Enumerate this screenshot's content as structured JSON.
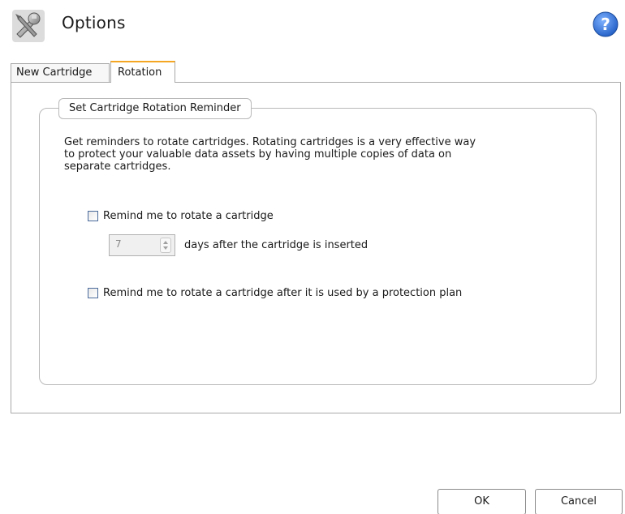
{
  "header": {
    "title": "Options",
    "icon": "tools-icon",
    "help_icon": "help-icon"
  },
  "tabs": [
    {
      "label": "New Cartridge",
      "active": false
    },
    {
      "label": "Rotation",
      "active": true
    }
  ],
  "rotation": {
    "group_title": "Set Cartridge Rotation Reminder",
    "description_lines": [
      "Get reminders to rotate cartridges. Rotating cartridges is a very effective way",
      "to protect your valuable data assets by having multiple copies of data on",
      "separate cartridges."
    ],
    "remind_rotate": {
      "label": "Remind me to rotate a cartridge",
      "checked": false
    },
    "days": {
      "value": "7",
      "label": "days after the cartridge is inserted",
      "enabled": false
    },
    "remind_after_plan": {
      "label": "Remind me to rotate a cartridge after it is used by a protection plan",
      "checked": false
    }
  },
  "buttons": {
    "ok": "OK",
    "cancel": "Cancel"
  },
  "colors": {
    "active_tab_accent": "#f5a623",
    "help_button": "#2f6fd6",
    "checkbox_border": "#4a6b9a"
  }
}
